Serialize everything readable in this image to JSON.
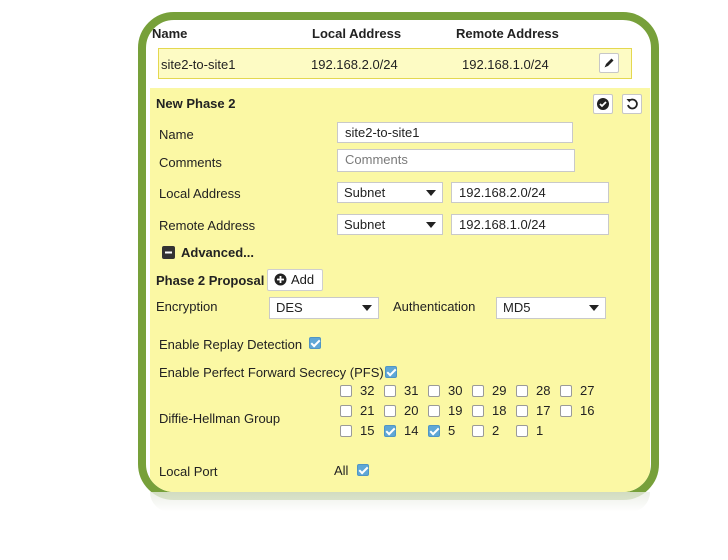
{
  "table": {
    "headers": [
      "Name",
      "Local Address",
      "Remote Address"
    ],
    "row": {
      "name": "site2-to-site1",
      "local": "192.168.2.0/24",
      "remote": "192.168.1.0/24"
    }
  },
  "phase2": {
    "title": "New Phase 2",
    "name_label": "Name",
    "name_value": "site2-to-site1",
    "comments_label": "Comments",
    "comments_placeholder": "Comments",
    "local_label": "Local Address",
    "local_type": "Subnet",
    "local_value": "192.168.2.0/24",
    "remote_label": "Remote Address",
    "remote_type": "Subnet",
    "remote_value": "192.168.1.0/24",
    "advanced_label": "Advanced...",
    "proposal_label": "Phase 2 Proposal",
    "add_label": "Add",
    "encryption_label": "Encryption",
    "encryption_value": "DES",
    "auth_label": "Authentication",
    "auth_value": "MD5",
    "replay_label": "Enable Replay Detection",
    "replay_checked": true,
    "pfs_label": "Enable Perfect Forward Secrecy (PFS)",
    "pfs_checked": true,
    "dh_label": "Diffie-Hellman Group",
    "dh_groups": [
      {
        "label": "32",
        "checked": false
      },
      {
        "label": "31",
        "checked": false
      },
      {
        "label": "30",
        "checked": false
      },
      {
        "label": "29",
        "checked": false
      },
      {
        "label": "28",
        "checked": false
      },
      {
        "label": "27",
        "checked": false
      },
      {
        "label": "21",
        "checked": false
      },
      {
        "label": "20",
        "checked": false
      },
      {
        "label": "19",
        "checked": false
      },
      {
        "label": "18",
        "checked": false
      },
      {
        "label": "17",
        "checked": false
      },
      {
        "label": "16",
        "checked": false
      },
      {
        "label": "15",
        "checked": false
      },
      {
        "label": "14",
        "checked": true
      },
      {
        "label": "5",
        "checked": true
      },
      {
        "label": "2",
        "checked": false
      },
      {
        "label": "1",
        "checked": false
      }
    ],
    "local_port_label": "Local Port",
    "local_port_all": "All",
    "local_port_checked": true
  },
  "icons": {
    "edit": "pencil-icon",
    "save": "check-circle-icon",
    "reset": "undo-icon",
    "add": "plus-circle-icon",
    "advanced": "minus-square-icon"
  },
  "colors": {
    "frame": "#77a03a",
    "panel": "#fbf8a4",
    "checkbox_on": "#5fa7d6",
    "row_highlight": "#fdfbc4"
  }
}
